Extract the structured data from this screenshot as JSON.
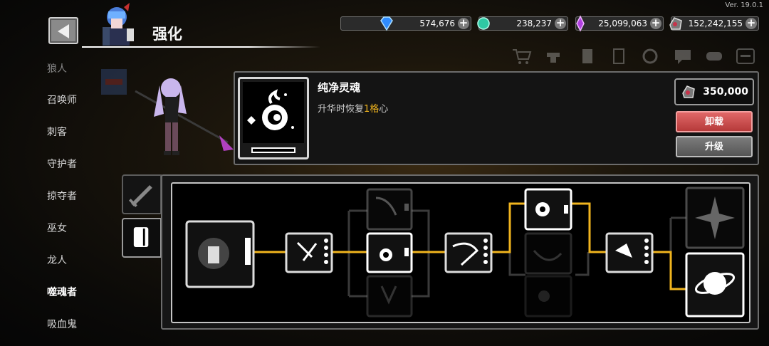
{
  "version": "Ver. 19.0.1",
  "header": {
    "title": "强化"
  },
  "currencies": [
    {
      "name": "diamond",
      "value": "574,676",
      "color": "#2f8cff"
    },
    {
      "name": "emerald-gem",
      "value": "238,237",
      "color": "#2fc9a4"
    },
    {
      "name": "purple-crystal",
      "value": "25,099,063",
      "color": "#b040e0"
    },
    {
      "name": "soul-stone",
      "value": "152,242,155",
      "color": "#c8324a"
    }
  ],
  "toolbar_icons": [
    "shop-cart-icon",
    "anvil-icon",
    "book-icon",
    "card-icon",
    "settings-gear-icon",
    "chat-icon",
    "gamepad-icon",
    "menu-icon"
  ],
  "sidebar": {
    "items": [
      {
        "label": "狼人",
        "state": "faded"
      },
      {
        "label": "召唤师",
        "state": "normal"
      },
      {
        "label": "刺客",
        "state": "normal"
      },
      {
        "label": "守护者",
        "state": "normal"
      },
      {
        "label": "掠夺者",
        "state": "normal"
      },
      {
        "label": "巫女",
        "state": "normal"
      },
      {
        "label": "龙人",
        "state": "normal"
      },
      {
        "label": "噬魂者",
        "state": "active"
      },
      {
        "label": "吸血鬼",
        "state": "normal"
      }
    ]
  },
  "item": {
    "name": "纯净灵魂",
    "desc_prefix": "升华时恢复",
    "desc_highlight": "1格",
    "desc_suffix": "心",
    "price": "350,000",
    "unequip_label": "卸载",
    "upgrade_label": "升级"
  },
  "tabs": [
    {
      "name": "weapon-tab",
      "icon": "sword-icon",
      "active": false
    },
    {
      "name": "book-tab",
      "icon": "book-icon",
      "active": true
    }
  ],
  "colors": {
    "path": "#f0b41e",
    "frame": "#c4c4c4",
    "highlight": "#f0b41e"
  }
}
